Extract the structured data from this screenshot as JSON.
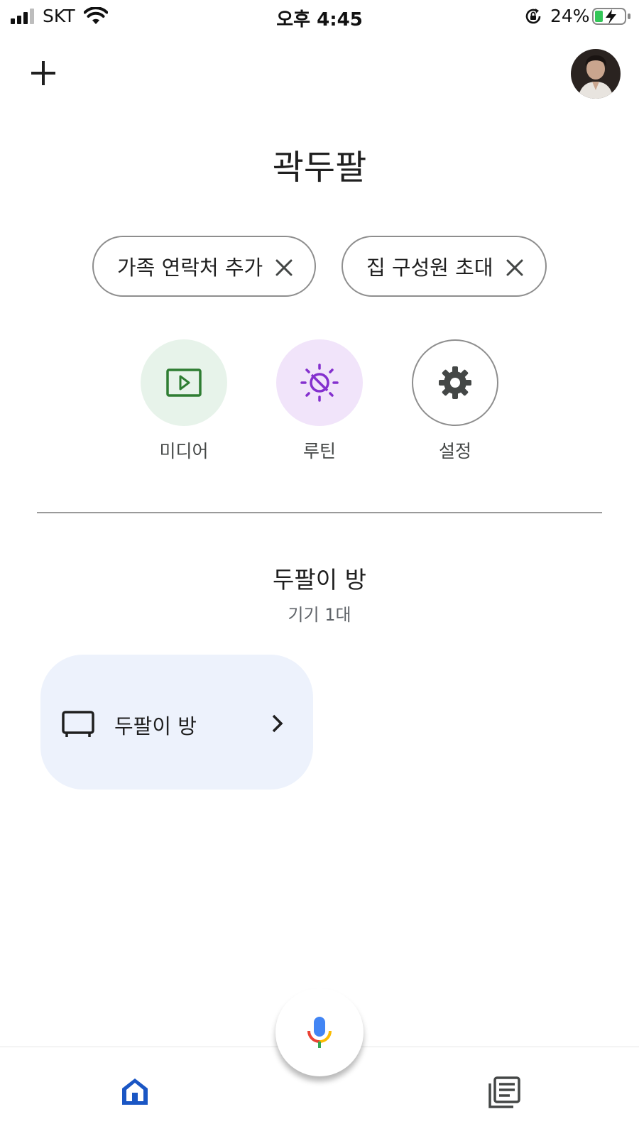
{
  "status_bar": {
    "carrier": "SKT",
    "time": "오후 4:45",
    "battery_percent": "24%",
    "icons": [
      "signal-icon",
      "wifi-icon",
      "rotation-lock-icon",
      "battery-charging-icon"
    ]
  },
  "header": {
    "add_icon": "plus-icon",
    "avatar": "profile-avatar"
  },
  "home": {
    "title": "곽두팔"
  },
  "chips": [
    {
      "label": "가족 연락처 추가",
      "icon": "close-icon"
    },
    {
      "label": "집 구성원 초대",
      "icon": "close-icon"
    }
  ],
  "actions": [
    {
      "label": "미디어",
      "icon": "media-play-icon",
      "color": "#2e7d32",
      "bg": "#e7f3ea"
    },
    {
      "label": "루틴",
      "icon": "routine-sun-icon",
      "color": "#8430ce",
      "bg": "#f1e4fa"
    },
    {
      "label": "설정",
      "icon": "gear-icon",
      "color": "#444746",
      "bg": "#ffffff"
    }
  ],
  "room": {
    "title": "두팔이 방",
    "subtitle": "기기 1대"
  },
  "devices": [
    {
      "name": "두팔이 방",
      "icon": "tv-icon"
    }
  ],
  "bottom_nav": {
    "items": [
      {
        "icon": "home-icon",
        "active": true,
        "color": "#1a56c4"
      },
      {
        "icon": "feed-icon",
        "active": false,
        "color": "#444746"
      }
    ],
    "mic_icon": "google-mic-icon"
  }
}
